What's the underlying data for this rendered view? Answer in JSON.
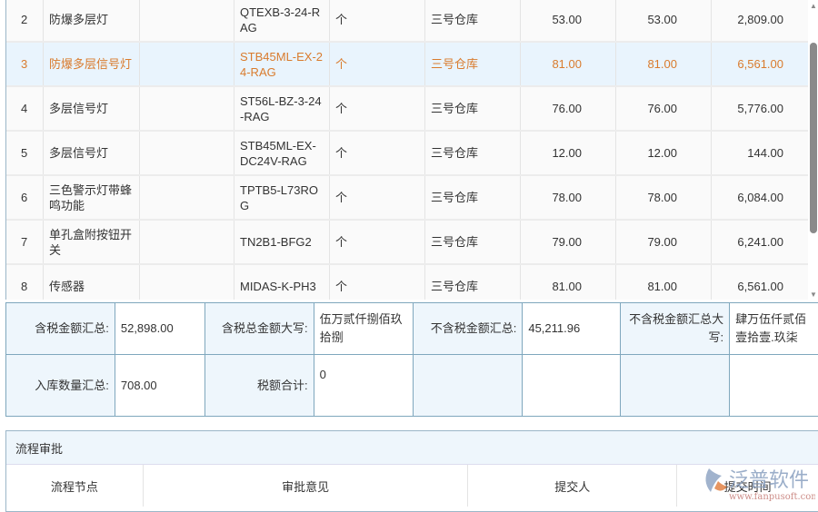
{
  "rows": [
    {
      "no": "2",
      "name": "防爆多层灯",
      "spec": "",
      "model": "QTEXB-3-24-RAG",
      "unit": "个",
      "warehouse": "三号仓库",
      "qty": "53.00",
      "qty2": "53.00",
      "amount": "2,809.00"
    },
    {
      "no": "3",
      "name": "防爆多层信号灯",
      "spec": "",
      "model": "STB45ML-EX-24-RAG",
      "unit": "个",
      "warehouse": "三号仓库",
      "qty": "81.00",
      "qty2": "81.00",
      "amount": "6,561.00"
    },
    {
      "no": "4",
      "name": "多层信号灯",
      "spec": "",
      "model": "ST56L-BZ-3-24-RAG",
      "unit": "个",
      "warehouse": "三号仓库",
      "qty": "76.00",
      "qty2": "76.00",
      "amount": "5,776.00"
    },
    {
      "no": "5",
      "name": "多层信号灯",
      "spec": "",
      "model": "STB45ML-EX-DC24V-RAG",
      "unit": "个",
      "warehouse": "三号仓库",
      "qty": "12.00",
      "qty2": "12.00",
      "amount": "144.00"
    },
    {
      "no": "6",
      "name": "三色警示灯带蜂鸣功能",
      "spec": "",
      "model": "TPTB5-L73ROG",
      "unit": "个",
      "warehouse": "三号仓库",
      "qty": "78.00",
      "qty2": "78.00",
      "amount": "6,084.00"
    },
    {
      "no": "7",
      "name": "单孔盒附按钮开关",
      "spec": "",
      "model": "TN2B1-BFG2",
      "unit": "个",
      "warehouse": "三号仓库",
      "qty": "79.00",
      "qty2": "79.00",
      "amount": "6,241.00"
    },
    {
      "no": "8",
      "name": "传感器",
      "spec": "",
      "model": "MIDAS-K-PH3",
      "unit": "个",
      "warehouse": "三号仓库",
      "qty": "81.00",
      "qty2": "81.00",
      "amount": "6,561.00"
    }
  ],
  "summary": {
    "tax_total_label": "含税金额汇总:",
    "tax_total": "52,898.00",
    "tax_upper_label": "含税总金额大写:",
    "tax_upper": "伍万贰仟捌佰玖拾捌",
    "notax_total_label": "不含税金额汇总:",
    "notax_total": "45,211.96",
    "notax_upper_label": "不含税金额汇总大写:",
    "notax_upper": "肆万伍仟贰佰壹拾壹.玖柒",
    "qty_total_label": "入库数量汇总:",
    "qty_total": "708.00",
    "tax_sum_label": "税额合计:",
    "tax_sum": "0"
  },
  "flow": {
    "title": "流程审批",
    "columns": [
      "流程节点",
      "审批意见",
      "提交人",
      "提交时间"
    ]
  },
  "watermark": {
    "brand": "泛普软件",
    "url": "www.fanpusoft.com"
  },
  "colors": {
    "selected_text": "#d97b2d",
    "selected_bg": "#e9f4fd",
    "label_bg": "#eef6fc"
  }
}
